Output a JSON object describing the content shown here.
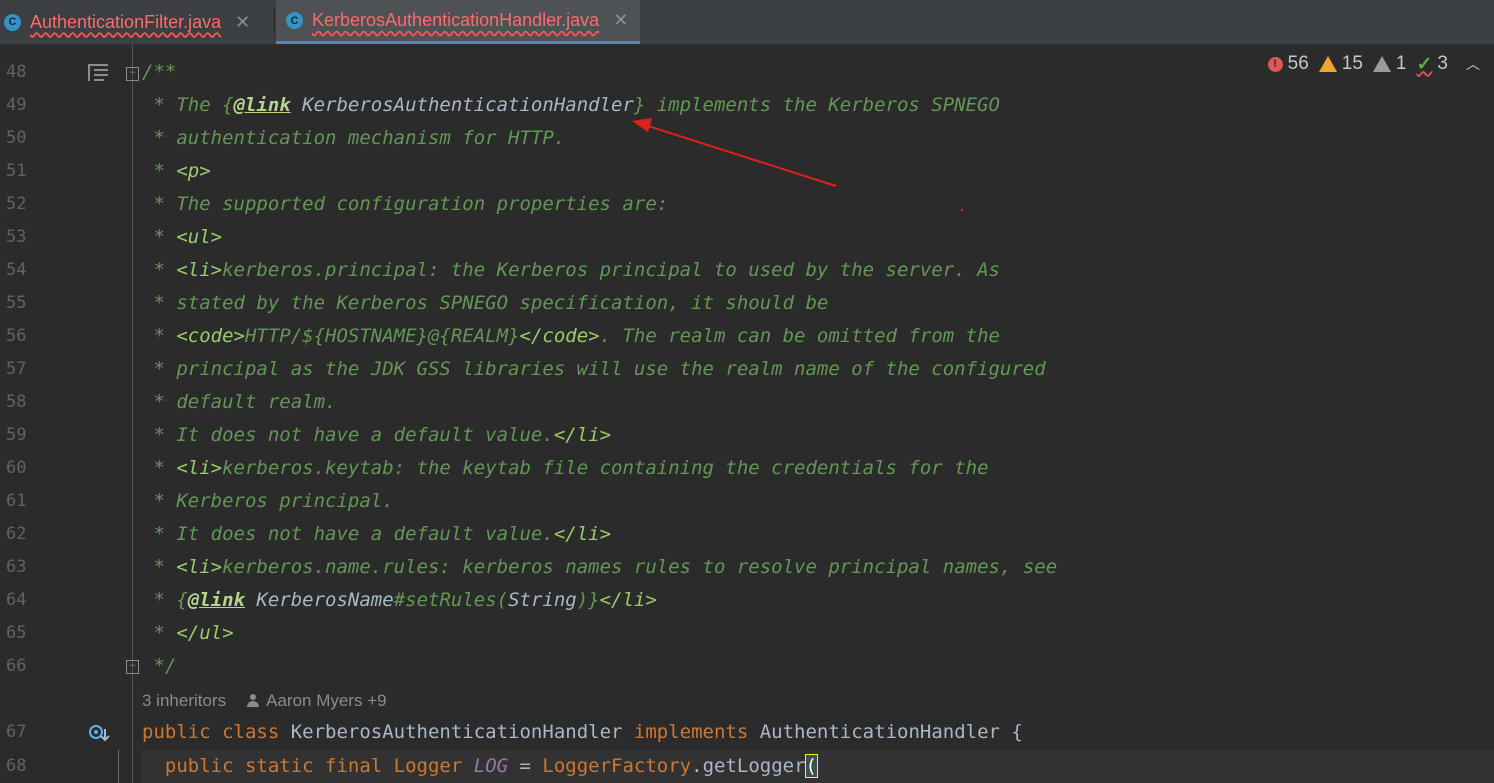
{
  "tabs": [
    {
      "label": "AuthenticationFilter.java",
      "icon": "C",
      "active": false
    },
    {
      "label": "KerberosAuthenticationHandler.java",
      "icon": "C",
      "active": true
    }
  ],
  "inspections": {
    "errors": "56",
    "warnings": "15",
    "weak_warnings": "1",
    "typos": "3"
  },
  "line_numbers": [
    "48",
    "49",
    "50",
    "51",
    "52",
    "53",
    "54",
    "55",
    "56",
    "57",
    "58",
    "59",
    "60",
    "61",
    "62",
    "63",
    "64",
    "65",
    "66",
    "67",
    "68"
  ],
  "code": {
    "l48": "/**",
    "l49a": " * The {",
    "l49b": "@link",
    "l49c": " KerberosAuthenticationHandler",
    "l49d": "} implements the Kerberos SPNEGO",
    "l50": " * authentication mechanism for HTTP.",
    "l51a": " * ",
    "l51b": "<p>",
    "l52": " * The supported configuration properties are:",
    "l53a": " * ",
    "l53b": "<ul>",
    "l54a": " * ",
    "l54b": "<li>",
    "l54c": "kerberos.principal: the Kerberos principal to used by the server. As",
    "l55": " * stated by the Kerberos SPNEGO specification, it should be",
    "l56a": " * ",
    "l56b": "<code>",
    "l56c": "HTTP/${HOSTNAME}@{REALM}",
    "l56d": "</code>",
    "l56e": ". The realm can be omitted from the",
    "l57": " * principal as the JDK GSS libraries will use the realm name of the configured",
    "l58": " * default realm.",
    "l59a": " * It does not have a default value.",
    "l59b": "</li>",
    "l60a": " * ",
    "l60b": "<li>",
    "l60c": "kerberos.keytab: the keytab file containing the credentials for the",
    "l61": " * Kerberos principal.",
    "l62a": " * It does not have a default value.",
    "l62b": "</li>",
    "l63a": " * ",
    "l63b": "<li>",
    "l63c": "kerberos.name.rules: kerberos names rules to resolve principal names, see",
    "l64a": " * {",
    "l64b": "@link",
    "l64c": " KerberosName",
    "l64d": "#setRules(",
    "l64e": "String",
    "l64f": ")}",
    "l64g": "</li>",
    "l65a": " * ",
    "l65b": "</ul>",
    "l66": " */",
    "l67a": "public class ",
    "l67b": "KerberosAuthenticationHandler ",
    "l67c": "implements ",
    "l67d": "AuthenticationHandler {",
    "l68a": "  public static final ",
    "l68b": "Logger ",
    "l68c": "LOG",
    "l68d": " = ",
    "l68e": "LoggerFactory",
    "l68f": ".getLogger",
    "l68g": "("
  },
  "hint": {
    "inheritors": "3 inheritors",
    "authors": "Aaron Myers +9"
  },
  "colors": {
    "doc": "#629755",
    "keyword": "#cc7832",
    "annotation_arrow": "#e0201b",
    "error": "#e05555",
    "warning": "#f0a732"
  }
}
